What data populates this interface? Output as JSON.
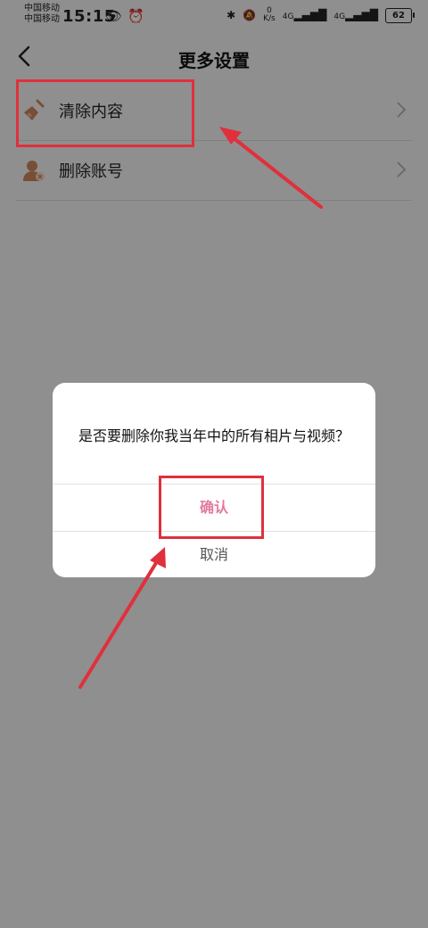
{
  "status_bar": {
    "carrier_1": "中国移动",
    "carrier_2": "中国移动",
    "time": "15:15",
    "net_speed_value": "0",
    "net_speed_unit": "K/s",
    "signal_1": "4G",
    "signal_2": "4G",
    "battery": "62"
  },
  "header": {
    "title": "更多设置"
  },
  "list": {
    "items": [
      {
        "label": "清除内容",
        "icon": "broom-icon"
      },
      {
        "label": "删除账号",
        "icon": "delete-user-icon"
      }
    ]
  },
  "dialog": {
    "message": "是否要删除你我当年中的所有相片与视频？",
    "confirm_label": "确认",
    "cancel_label": "取消"
  },
  "colors": {
    "annotation_red": "#e0303c",
    "confirm_pink": "#e27a9f",
    "icon_brown": "#c8825a"
  }
}
